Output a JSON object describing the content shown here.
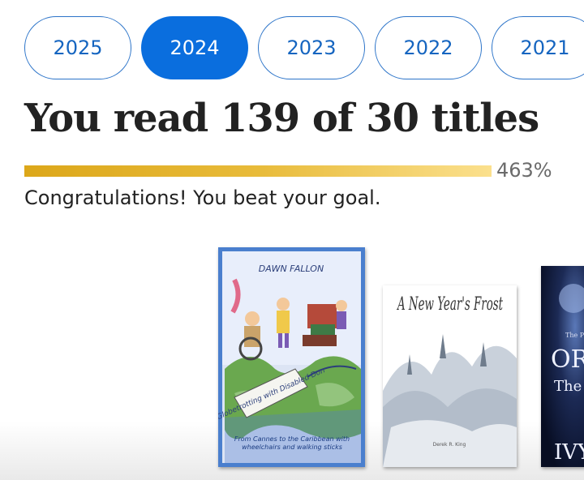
{
  "year_tabs": [
    {
      "label": "2025",
      "selected": false
    },
    {
      "label": "2024",
      "selected": true
    },
    {
      "label": "2023",
      "selected": false
    },
    {
      "label": "2022",
      "selected": false
    },
    {
      "label": "2021",
      "selected": false
    }
  ],
  "summary": {
    "headline": "You read 139 of 30 titles",
    "progress_percent_label": "463%",
    "progress_fraction": 1.0,
    "message": "Congratulations! You beat your goal."
  },
  "books": [
    {
      "title": "Globetrotting with Disabled Don",
      "author": "DAWN FALLON",
      "subtitle": "From Cannes to the Caribbean with wheelchairs and walking sticks"
    },
    {
      "title": "A New Year's Frost",
      "author": "Derek R. King"
    },
    {
      "title_partial": "OR",
      "line_partial": "The L",
      "author_partial": "IVY",
      "series_partial": "The Pr"
    }
  ],
  "colors": {
    "accent_blue": "#0a6ede",
    "progress_gold": "#dca71a",
    "progress_gold_light": "#fbe08d"
  }
}
